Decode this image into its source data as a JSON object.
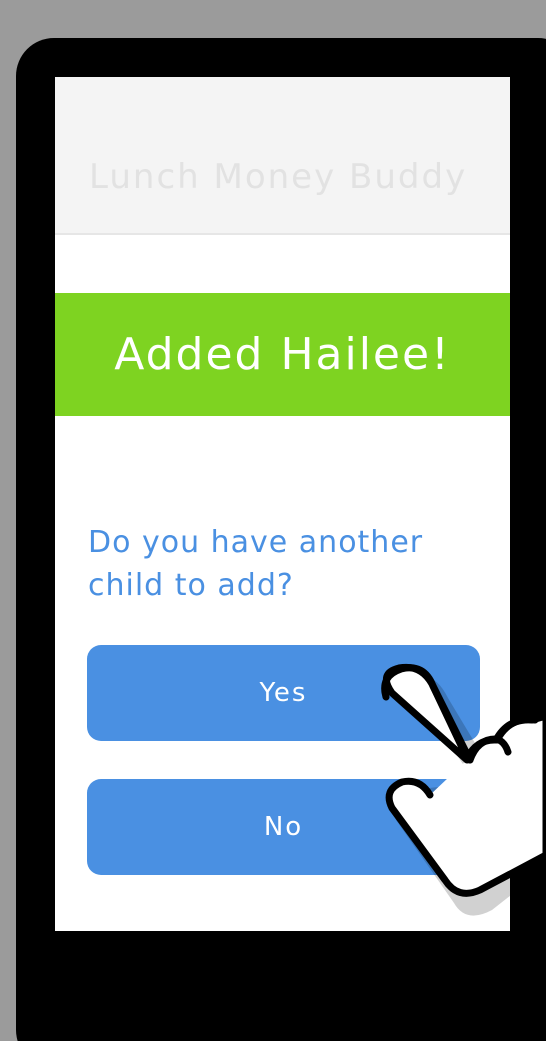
{
  "app": {
    "title": "Lunch Money Buddy"
  },
  "banner": {
    "text": "Added Hailee!"
  },
  "prompt": {
    "question": "Do you have another child to add?"
  },
  "actions": {
    "yes_label": "Yes",
    "no_label": "No"
  },
  "colors": {
    "background": "#9b9b9b",
    "device": "#000000",
    "header": "#f4f4f4",
    "banner": "#7ed321",
    "accent": "#4a90e2"
  },
  "icons": {
    "pointer": "hand-pointer-icon"
  }
}
